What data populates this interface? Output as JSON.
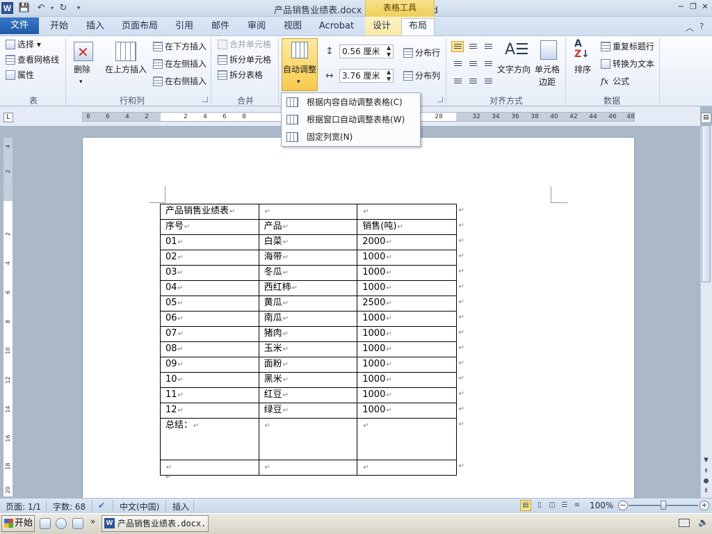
{
  "window": {
    "title": "产品销售业绩表.docx - Microsoft Word",
    "context_tab_header": "表格工具",
    "word_logo": "W",
    "taskbar_label": "产品销售业绩表.docx..."
  },
  "tabs": [
    "文件",
    "开始",
    "插入",
    "页面布局",
    "引用",
    "邮件",
    "审阅",
    "视图",
    "Acrobat",
    "设计",
    "布局"
  ],
  "ribbon": {
    "group_table": {
      "label": "表",
      "select": "选择",
      "gridlines": "查看网格线",
      "properties": "属性"
    },
    "group_rows_cols": {
      "label": "行和列",
      "delete": "删除",
      "insert_above": "在上方插入",
      "insert_below": "在下方插入",
      "insert_left": "在左侧插入",
      "insert_right": "在右侧插入"
    },
    "group_merge": {
      "label": "合并",
      "merge_cells": "合并单元格",
      "split_cells": "拆分单元格",
      "split_table": "拆分表格"
    },
    "group_cell_size": {
      "autofit": "自动调整",
      "height_value": "0.56 厘米",
      "width_value": "3.76 厘米",
      "distribute_rows": "分布行",
      "distribute_cols": "分布列"
    },
    "group_alignment": {
      "label": "对齐方式",
      "text_direction": "文字方向",
      "cell_margins_1": "单元格",
      "cell_margins_2": "边距"
    },
    "group_data": {
      "label": "数据",
      "sort": "排序",
      "repeat_header": "重复标题行",
      "convert_to_text": "转换为文本",
      "formula": "公式"
    }
  },
  "autofit_menu": {
    "items": [
      {
        "label": "根据内容自动调整表格(C)"
      },
      {
        "label": "根据窗口自动调整表格(W)"
      },
      {
        "label": "固定列宽(N)"
      }
    ]
  },
  "ruler": {
    "h_ticks": [
      "8",
      "6",
      "4",
      "2",
      "2",
      "4",
      "6",
      "8",
      "28",
      "32",
      "34",
      "36",
      "38",
      "40",
      "42",
      "44",
      "46",
      "48"
    ],
    "v_ticks": [
      "4",
      "2",
      "2",
      "4",
      "6",
      "8",
      "10",
      "12",
      "14",
      "16",
      "18",
      "20"
    ]
  },
  "document": {
    "table": [
      [
        "产品销售业绩表",
        "",
        ""
      ],
      [
        "序号",
        "产品",
        "销售(吨)"
      ],
      [
        "01",
        "白菜",
        "2000"
      ],
      [
        "02",
        "海带",
        "1000"
      ],
      [
        "03",
        "冬瓜",
        "1000"
      ],
      [
        "04",
        "西红柿",
        "1000"
      ],
      [
        "05",
        "黄瓜",
        "2500"
      ],
      [
        "06",
        "南瓜",
        "1000"
      ],
      [
        "07",
        "猪肉",
        "1000"
      ],
      [
        "08",
        "玉米",
        "1000"
      ],
      [
        "09",
        "面粉",
        "1000"
      ],
      [
        "10",
        "黑米",
        "1000"
      ],
      [
        "11",
        "红豆",
        "1000"
      ],
      [
        "12",
        "绿豆",
        "1000"
      ],
      [
        "总结：",
        "",
        ""
      ],
      [
        "",
        "",
        ""
      ]
    ],
    "paragraph_mark": "↵",
    "row_end_mark": "↵"
  },
  "status": {
    "page": "页面: 1/1",
    "words": "字数: 68",
    "language": "中文(中国)",
    "mode": "插入",
    "zoom": "100%"
  },
  "taskbar": {
    "start": "开始"
  },
  "colors": {
    "file_tab": "#1e5aa8",
    "context_tab": "#efcf5a",
    "highlight": "#fde58a"
  }
}
